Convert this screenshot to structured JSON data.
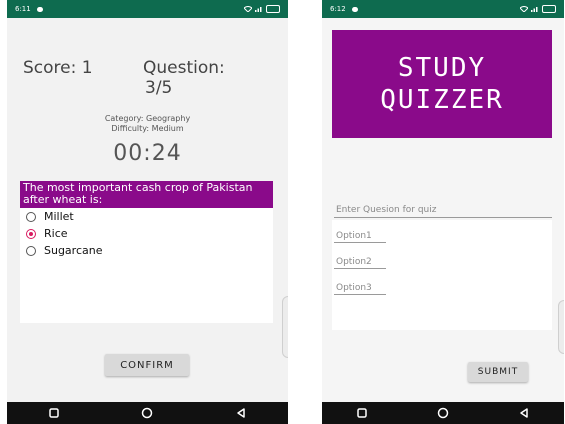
{
  "screen1": {
    "status_time": "6:11",
    "score": "Score: 1",
    "question_label": "Question:",
    "question_number": "3/5",
    "category": "Category: Geography",
    "difficulty": "Difficulty: Medium",
    "timer": "00:24",
    "question_text": "The most important cash crop of Pakistan after wheat is:",
    "options": [
      "Millet",
      "Rice",
      "Sugarcane"
    ],
    "selected_option": "Rice",
    "confirm_label": "CONFIRM"
  },
  "screen2": {
    "status_time": "6:12",
    "banner_line1": "STUDY",
    "banner_line2": "QUIZZER",
    "question_placeholder": "Enter Quesion for quiz",
    "option1_placeholder": "Option1",
    "option2_placeholder": "Option2",
    "option3_placeholder": "Option3",
    "submit_label": "SUBMIT"
  },
  "colors": {
    "accent_purple": "#8a0a8a",
    "status_green": "#0e6b4f",
    "radio_checked": "#d81b60"
  },
  "icons": [
    "wifi-icon",
    "signal-icon",
    "battery-icon",
    "back-icon",
    "home-icon",
    "recents-icon"
  ]
}
